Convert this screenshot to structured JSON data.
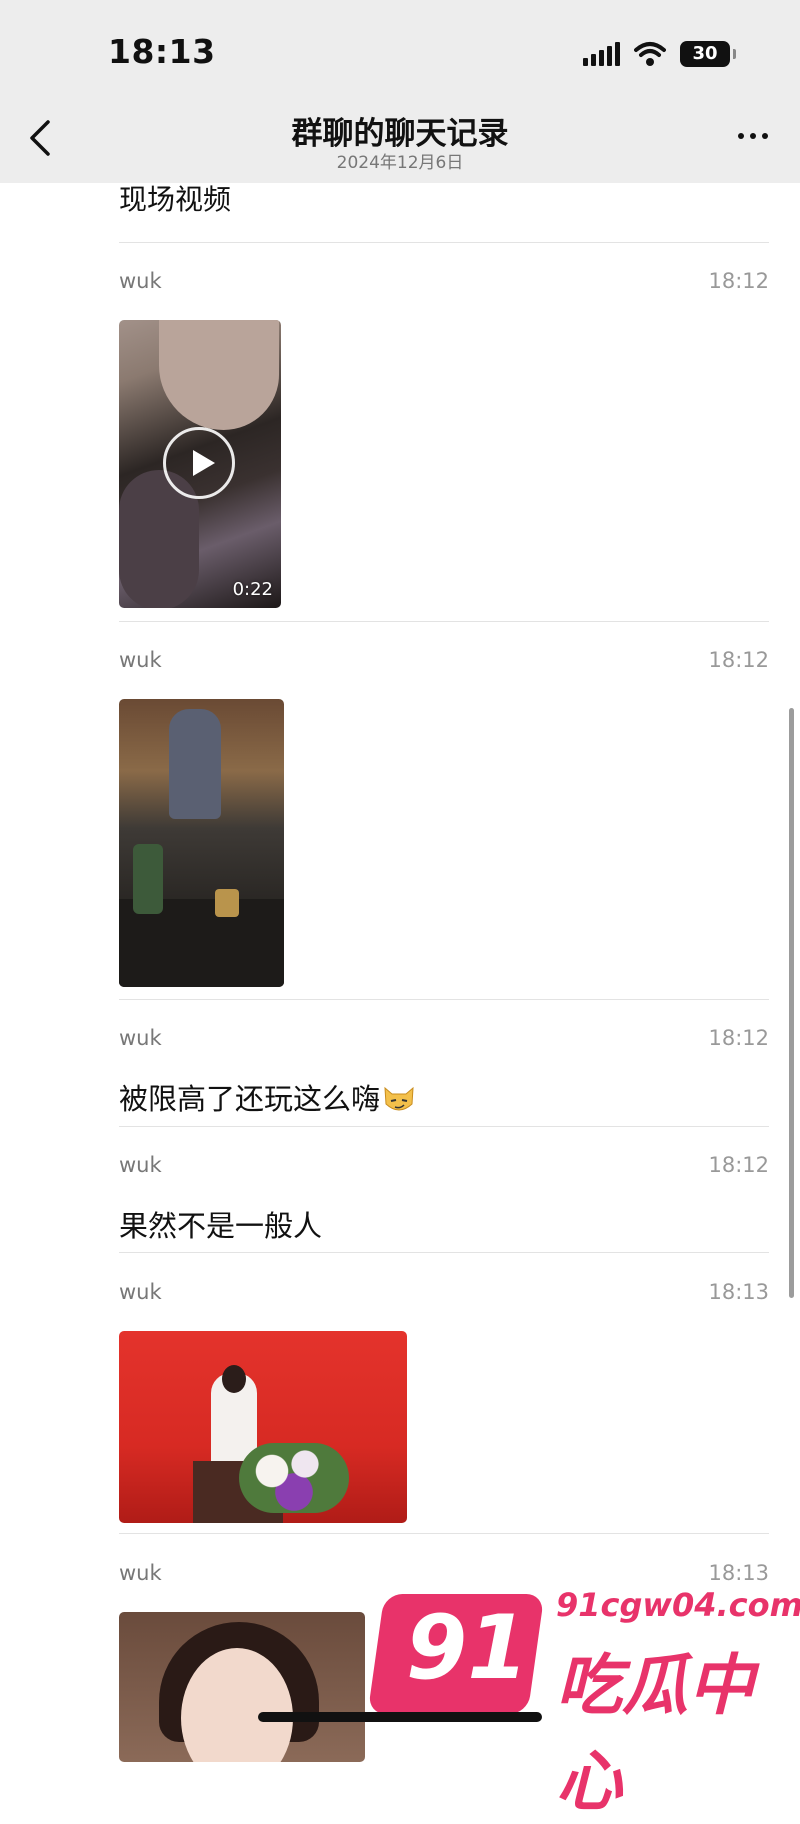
{
  "status_bar": {
    "time": "18:13",
    "battery": "30"
  },
  "nav": {
    "title": "群聊的聊天记录",
    "subtitle": "2024年12月6日"
  },
  "pre_text": "现场视频",
  "messages": [
    {
      "sender": "wuk",
      "time": "18:12",
      "type": "video",
      "duration": "0:22"
    },
    {
      "sender": "wuk",
      "time": "18:12",
      "type": "image"
    },
    {
      "sender": "wuk",
      "time": "18:12",
      "type": "text",
      "text": "被限高了还玩这么嗨"
    },
    {
      "sender": "wuk",
      "time": "18:12",
      "type": "text",
      "text": "果然不是一般人"
    },
    {
      "sender": "wuk",
      "time": "18:13",
      "type": "image"
    },
    {
      "sender": "wuk",
      "time": "18:13",
      "type": "image"
    }
  ],
  "watermark": {
    "number": "91",
    "url": "91cgw04.com",
    "name": "吃瓜中心"
  },
  "colors": {
    "nav_bg": "#ededed",
    "divider": "#e3e3e3",
    "watermark": "#e8336a"
  }
}
